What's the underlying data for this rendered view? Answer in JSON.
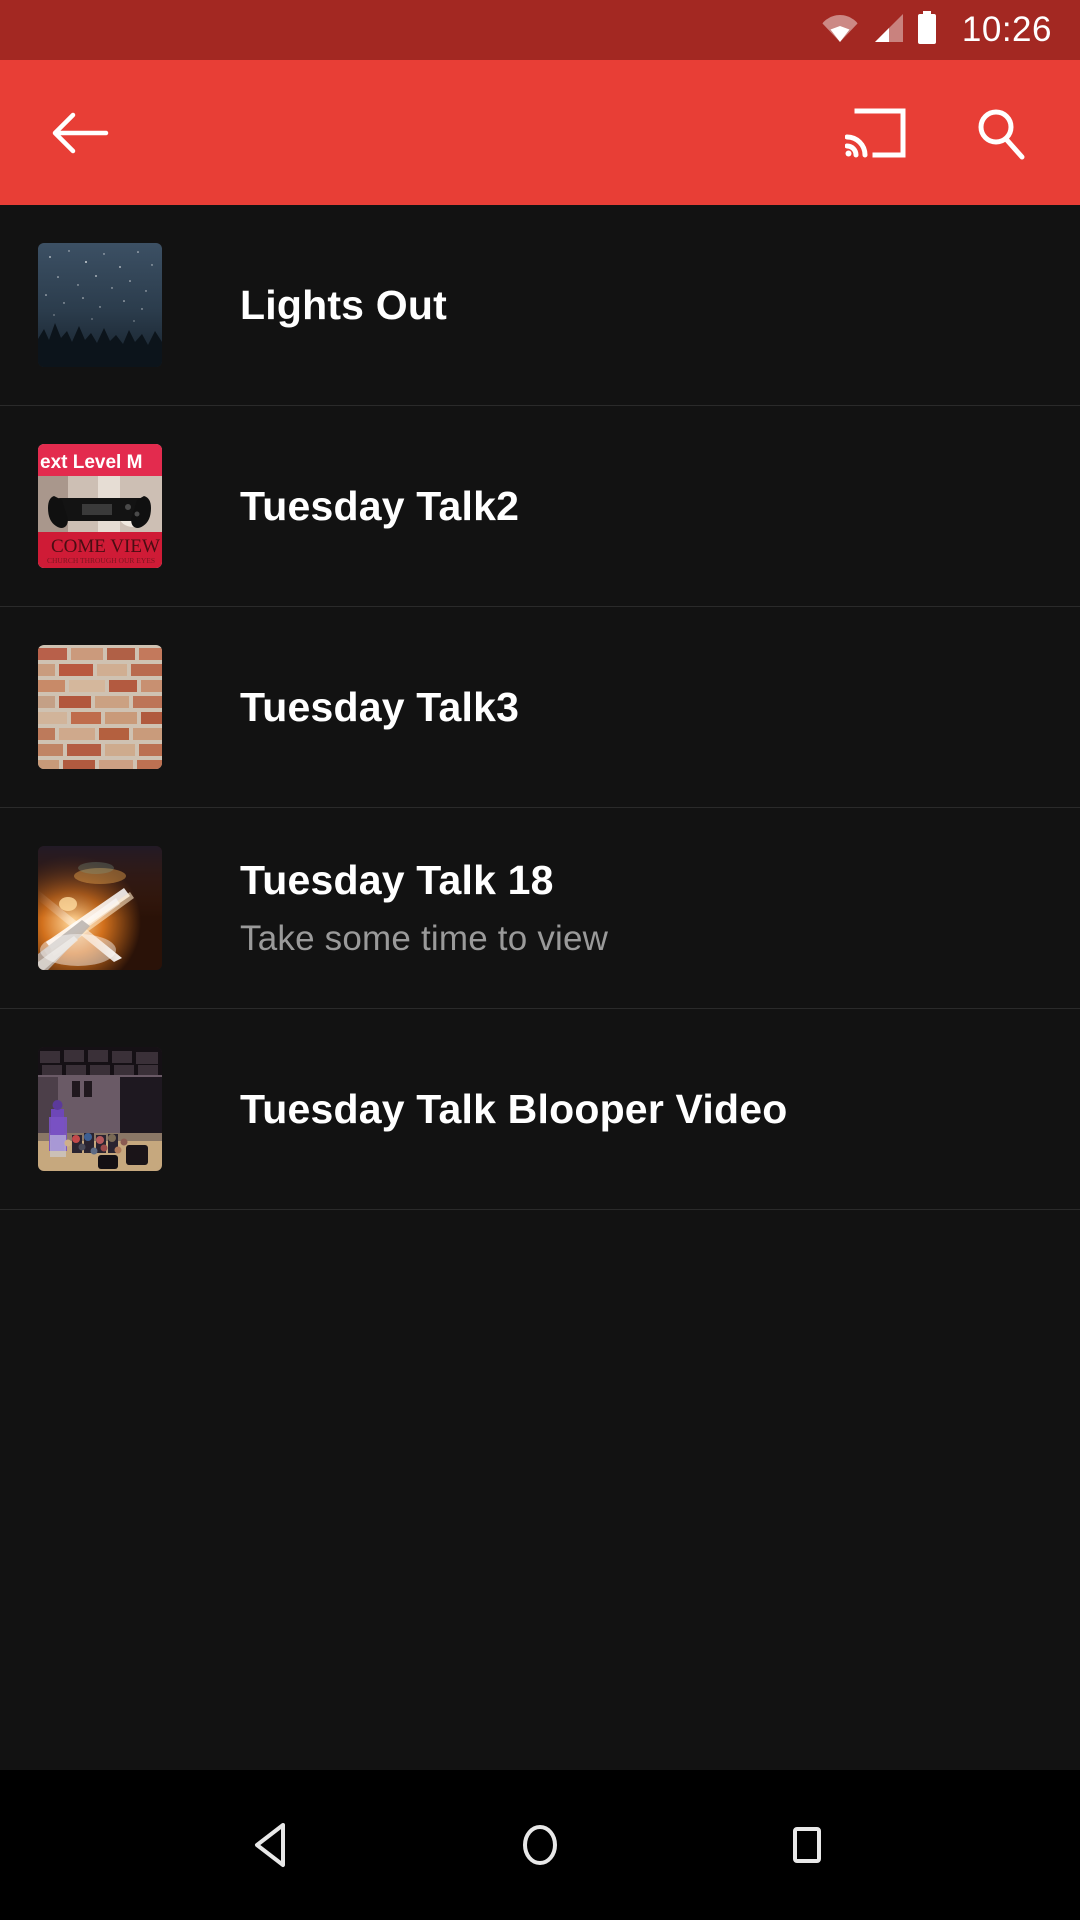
{
  "status_bar": {
    "time": "10:26",
    "icons": [
      "wifi-icon",
      "cellular-signal-icon",
      "battery-icon"
    ],
    "background_color": "#a32822"
  },
  "app_bar": {
    "background_color": "#e83e36",
    "back_label": "Back",
    "cast_label": "Cast",
    "search_label": "Search",
    "icons": [
      "back-arrow-icon",
      "cast-icon",
      "search-icon"
    ]
  },
  "list": {
    "items": [
      {
        "title": "Lights Out",
        "subtitle": "",
        "thumbnail": "night-sky-trees-thumbnail"
      },
      {
        "title": "Tuesday Talk2",
        "subtitle": "",
        "thumbnail": "next-level-come-view-thumbnail",
        "thumbnail_text_top": "ext Level Me",
        "thumbnail_text_bottom": "COME VIEW",
        "thumbnail_text_bottom_small": "CHURCH THROUGH OUR EYES"
      },
      {
        "title": "Tuesday Talk3",
        "subtitle": "",
        "thumbnail": "brick-wall-thumbnail"
      },
      {
        "title": "Tuesday Talk 18",
        "subtitle": "Take some time to view",
        "thumbnail": "light-trails-road-thumbnail"
      },
      {
        "title": "Tuesday Talk Blooper Video",
        "subtitle": "",
        "thumbnail": "auditorium-stage-thumbnail"
      }
    ]
  },
  "nav_bar": {
    "background_color": "#000000",
    "back_label": "Back",
    "home_label": "Home",
    "recents_label": "Recent apps",
    "icons": [
      "nav-back-triangle-icon",
      "nav-home-circle-icon",
      "nav-recents-square-icon"
    ]
  },
  "theme": {
    "page_background": "#121212",
    "accent": "#e83e36",
    "title_color": "#ffffff",
    "subtitle_color": "#9a9a9a",
    "divider_color": "#2a2a2a"
  }
}
